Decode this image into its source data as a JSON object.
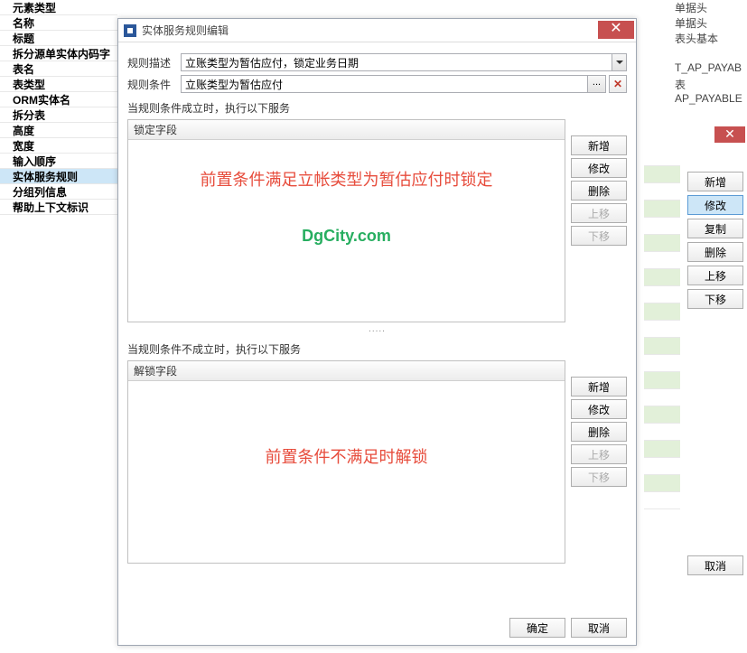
{
  "props": {
    "items": [
      {
        "label": "元素类型"
      },
      {
        "label": "名称"
      },
      {
        "label": "标题"
      },
      {
        "label": "拆分源单实体内码字"
      },
      {
        "label": "表名"
      },
      {
        "label": "表类型"
      },
      {
        "label": "ORM实体名"
      },
      {
        "label": "拆分表"
      },
      {
        "label": "高度"
      },
      {
        "label": "宽度"
      },
      {
        "label": "输入顺序"
      },
      {
        "label": "实体服务规则",
        "selected": true
      },
      {
        "label": "分组列信息"
      },
      {
        "label": "帮助上下文标识"
      }
    ]
  },
  "right": {
    "rows": [
      "单据头",
      "单据头",
      "表头基本",
      "",
      "T_AP_PAYAB",
      "表",
      "AP_PAYABLE"
    ],
    "buttons": {
      "add": "新增",
      "edit": "修改",
      "copy": "复制",
      "delete": "删除",
      "up": "上移",
      "down": "下移"
    },
    "cancel": "取消"
  },
  "dialog": {
    "title": "实体服务规则编辑",
    "form": {
      "desc_label": "规则描述",
      "desc_value": "立账类型为暂估应付，锁定业务日期",
      "cond_label": "规则条件",
      "cond_value": "立账类型为暂估应付",
      "ellipsis": "..."
    },
    "section_true": {
      "label": "当规则条件成立时，执行以下服务",
      "header": "锁定字段",
      "annotation": "前置条件满足立帐类型为暂估应付时锁定",
      "watermark": "DgCity.com"
    },
    "section_false": {
      "label": "当规则条件不成立时，执行以下服务",
      "header": "解锁字段",
      "annotation": "前置条件不满足时解锁"
    },
    "buttons": {
      "add": "新增",
      "edit": "修改",
      "delete": "删除",
      "up": "上移",
      "down": "下移"
    },
    "divider": ".....",
    "footer": {
      "ok": "确定",
      "cancel": "取消"
    }
  }
}
